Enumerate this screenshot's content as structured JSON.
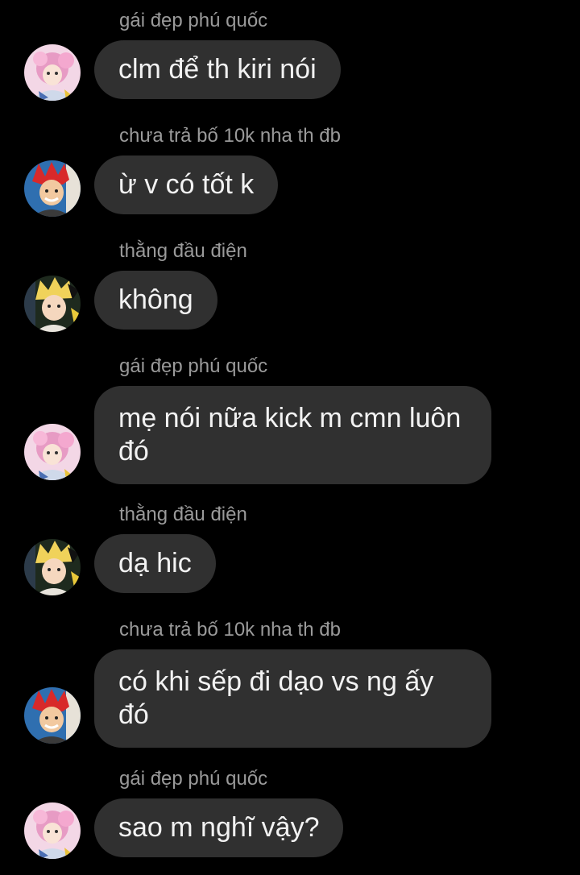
{
  "messages": [
    {
      "sender": "gái đẹp phú quốc",
      "text": "clm để th kiri nói",
      "avatar": "pink-character-avatar"
    },
    {
      "sender": "chưa trả bố 10k nha th đb",
      "text": "ừ v có tốt k",
      "avatar": "red-hair-character-avatar"
    },
    {
      "sender": "thằng đầu điện",
      "text": "không",
      "avatar": "blonde-character-avatar"
    },
    {
      "sender": "gái đẹp phú quốc",
      "text": "mẹ nói nữa kick m cmn luôn đó",
      "avatar": "pink-character-avatar"
    },
    {
      "sender": "thằng đầu điện",
      "text": "dạ hic",
      "avatar": "blonde-character-avatar"
    },
    {
      "sender": "chưa trả bố 10k nha th đb",
      "text": "có khi sếp đi dạo vs ng ấy đó",
      "avatar": "red-hair-character-avatar"
    },
    {
      "sender": "gái đẹp phú quốc",
      "text": "sao m nghĩ vậy?",
      "avatar": "pink-character-avatar"
    }
  ],
  "colors": {
    "background": "#000000",
    "bubble": "#303030",
    "bubble_text": "#f2f2f2",
    "sender_text": "#9a9a9a"
  }
}
